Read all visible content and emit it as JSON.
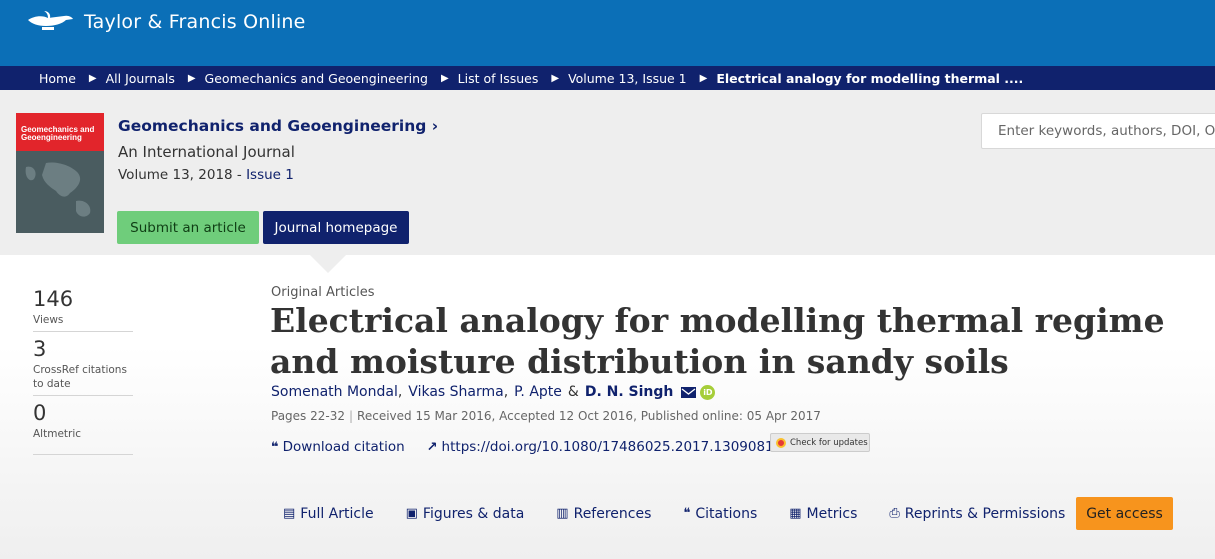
{
  "header": {
    "logo_text": "Taylor & Francis Online",
    "logo_icon": "lamp-icon",
    "brand_color": "#0b6fb7"
  },
  "breadcrumb": {
    "items": [
      "Home",
      "All Journals",
      "Geomechanics and Geoengineering",
      "List of Issues",
      "Volume 13, Issue 1",
      "Electrical analogy for modelling thermal ...."
    ],
    "bg_color": "#10226d"
  },
  "journal": {
    "cover_title": "Geomechanics and Geoengineering",
    "title": "Geomechanics and Geoengineering",
    "chevron": "›",
    "subtitle": "An International Journal",
    "volume_prefix": "Volume 13, 2018 - ",
    "issue_link": "Issue 1",
    "submit_label": "Submit an article",
    "homepage_label": "Journal homepage"
  },
  "search": {
    "placeholder": "Enter keywords, authors, DOI, ORCID"
  },
  "metrics": [
    {
      "value": "146",
      "label": "Views"
    },
    {
      "value": "3",
      "label": "CrossRef citations to date"
    },
    {
      "value": "0",
      "label": "Altmetric"
    }
  ],
  "article": {
    "type": "Original Articles",
    "title": "Electrical analogy for modelling thermal regime and moisture distribution in sandy soils",
    "authors": [
      "Somenath Mondal",
      "Vikas Sharma",
      "P. Apte",
      "D. N. Singh"
    ],
    "amp": "&",
    "pages": "Pages 22-32",
    "received": "Received 15 Mar 2016, Accepted 12 Oct 2016, Published online: 05 Apr 2017",
    "download_citation": "Download citation",
    "doi": "https://doi.org/10.1080/17486025.2017.1309081",
    "check_updates": "Check for updates"
  },
  "tabs": [
    {
      "label": "Full Article",
      "icon": "document-icon"
    },
    {
      "label": "Figures & data",
      "icon": "image-icon"
    },
    {
      "label": "References",
      "icon": "book-icon"
    },
    {
      "label": "Citations",
      "icon": "quote-icon"
    },
    {
      "label": "Metrics",
      "icon": "bar-chart-icon"
    },
    {
      "label": "Reprints & Permissions",
      "icon": "print-icon"
    }
  ],
  "get_access": "Get access"
}
